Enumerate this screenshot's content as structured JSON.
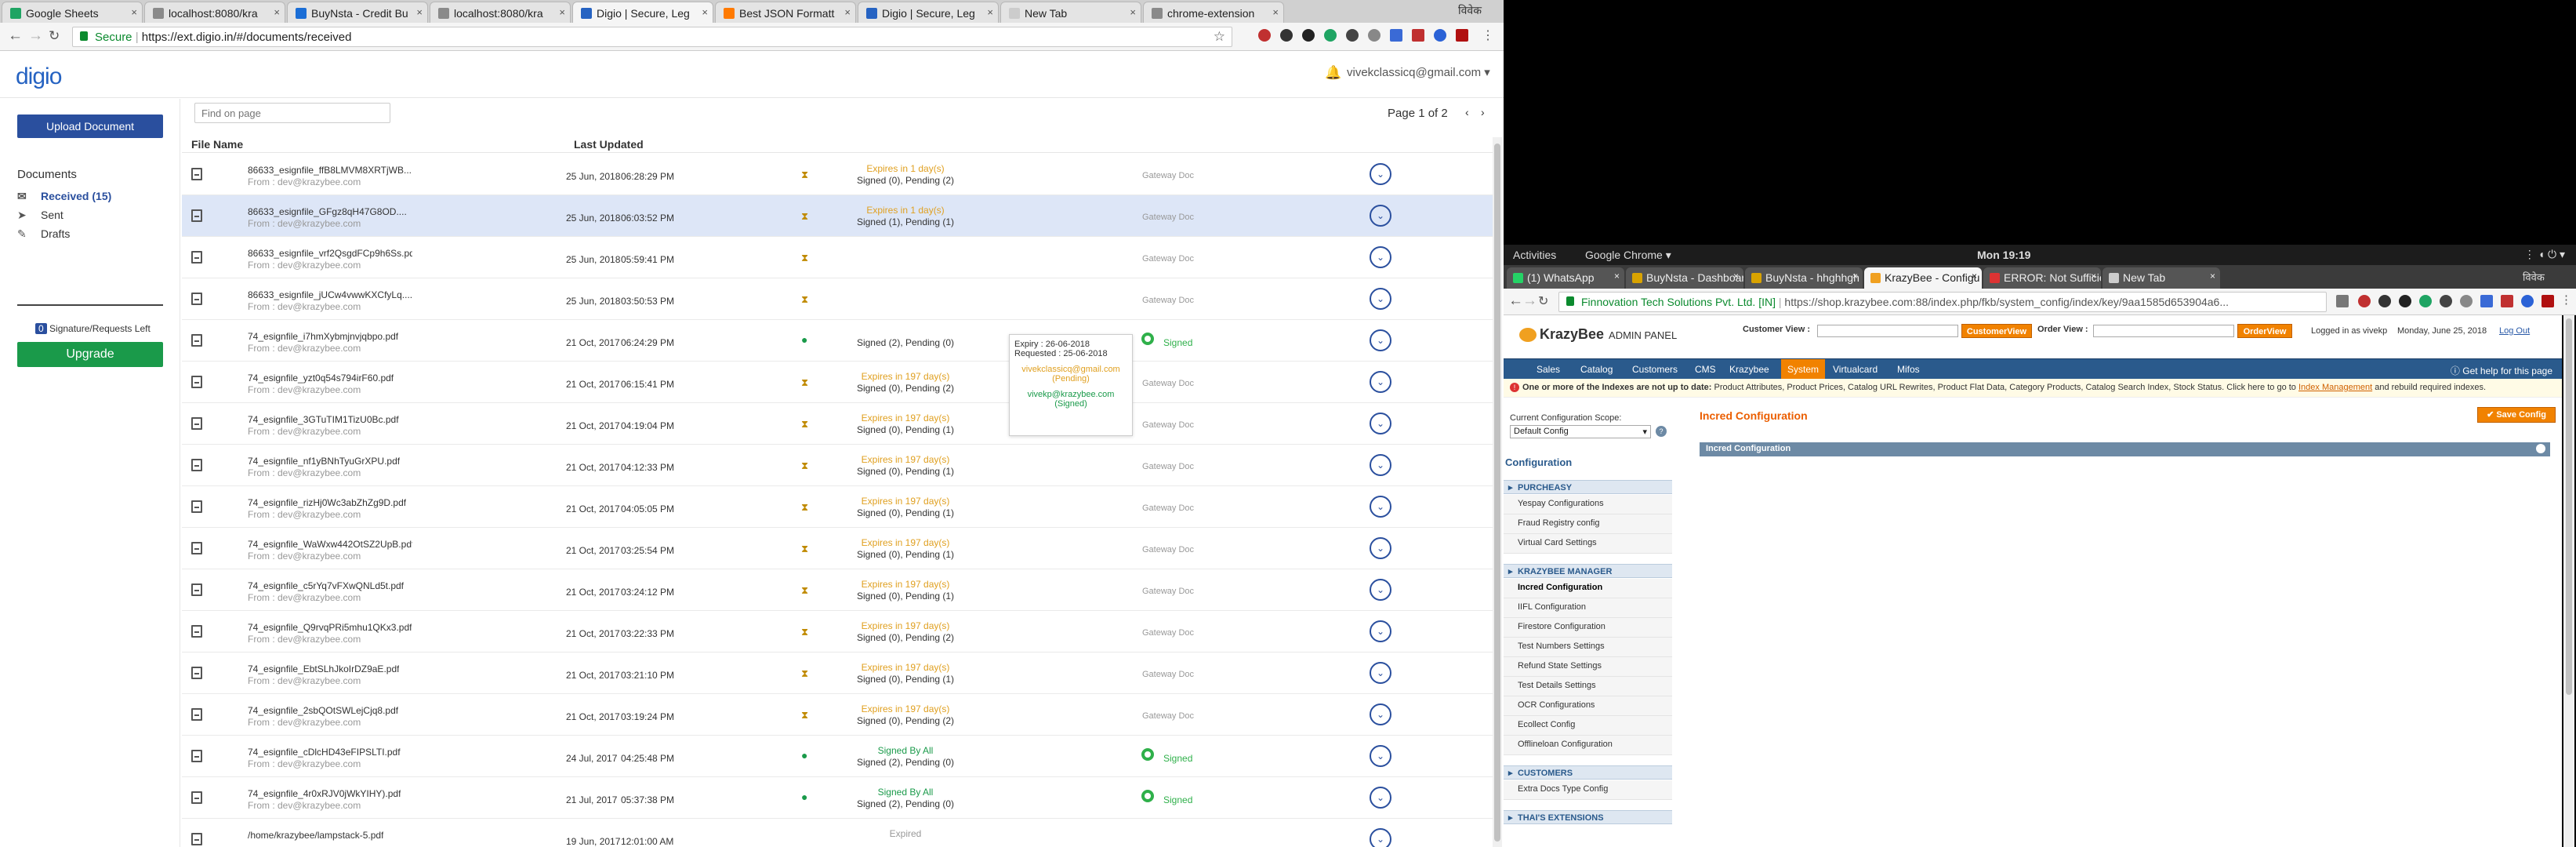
{
  "left_browser": {
    "tabs": [
      {
        "label": "Google Sheets",
        "color": "#1fa463"
      },
      {
        "label": "localhost:8080/kra",
        "color": "#8a8a8a"
      },
      {
        "label": "BuyNsta - Credit Bu",
        "color": "#1b6ed6"
      },
      {
        "label": "localhost:8080/kra",
        "color": "#8a8a8a"
      },
      {
        "label": "Digio | Secure, Leg",
        "color": "#2663c2"
      },
      {
        "label": "Best JSON Formatt",
        "color": "#ff7a00"
      },
      {
        "label": "Digio | Secure, Leg",
        "color": "#2663c2"
      },
      {
        "label": "New Tab",
        "color": "#cccccc"
      },
      {
        "label": "chrome-extension",
        "color": "#8a8a8a"
      }
    ],
    "profile_label": "विवेक",
    "secure_label": "Secure",
    "url": "https://ext.digio.in/#/documents/received"
  },
  "digio": {
    "logo": "digio",
    "user_email": "vivekclassicq@gmail.com",
    "upload_label": "Upload Document",
    "documents_heading": "Documents",
    "nav": [
      {
        "label": "Received (15)",
        "icon": "inbox-icon",
        "selected": true
      },
      {
        "label": "Sent",
        "icon": "send-icon",
        "selected": false
      },
      {
        "label": "Drafts",
        "icon": "pencil-icon",
        "selected": false
      }
    ],
    "signature_count": "0",
    "signature_label": "Signature/Requests Left",
    "upgrade_label": "Upgrade",
    "find_placeholder": "Find on page",
    "page_info": "Page 1 of 2",
    "columns": {
      "file": "File Name",
      "updated": "Last Updated"
    },
    "rows": [
      {
        "file": "86633_esignfile_ffB8LMVM8XRTjWB....",
        "from": "From : dev@krazybee.com",
        "date": "25 Jun, 2018",
        "time": "06:28:29 PM",
        "status": "pending",
        "line1": "Expires in 1 day(s)",
        "line2": "Signed (0), Pending (2)",
        "gateway": "Gateway Doc",
        "signed": ""
      },
      {
        "file": "86633_esignfile_GFgz8qH47G8OD....",
        "from": "From : dev@krazybee.com",
        "date": "25 Jun, 2018",
        "time": "06:03:52 PM",
        "status": "pending",
        "line1": "Expires in 1 day(s)",
        "line2": "Signed (1), Pending (1)",
        "gateway": "Gateway Doc",
        "signed": ""
      },
      {
        "file": "86633_esignfile_vrf2QsgdFCp9h6Ss.pdf",
        "from": "From : dev@krazybee.com",
        "date": "25 Jun, 2018",
        "time": "05:59:41 PM",
        "status": "pending",
        "line1": "",
        "line2": "",
        "gateway": "Gateway Doc",
        "signed": ""
      },
      {
        "file": "86633_esignfile_jUCw4vwwKXCfyLq....",
        "from": "From : dev@krazybee.com",
        "date": "25 Jun, 2018",
        "time": "03:50:53 PM",
        "status": "pending",
        "line1": "",
        "line2": "",
        "gateway": "Gateway Doc",
        "signed": ""
      },
      {
        "file": "74_esignfile_i7hmXybmjnvjqbpo.pdf",
        "from": "From : dev@krazybee.com",
        "date": "21 Oct, 2017",
        "time": "06:24:29 PM",
        "status": "ok",
        "line1": "",
        "line2": "Signed (2), Pending (0)",
        "gateway": "",
        "signed": "Signed"
      },
      {
        "file": "74_esignfile_yzt0q54s794irF60.pdf",
        "from": "From : dev@krazybee.com",
        "date": "21 Oct, 2017",
        "time": "06:15:41 PM",
        "status": "pending",
        "line1": "Expires in 197 day(s)",
        "line2": "Signed (0), Pending (2)",
        "gateway": "Gateway Doc",
        "signed": ""
      },
      {
        "file": "74_esignfile_3GTuTIM1TizU0Bc.pdf",
        "from": "From : dev@krazybee.com",
        "date": "21 Oct, 2017",
        "time": "04:19:04 PM",
        "status": "pending",
        "line1": "Expires in 197 day(s)",
        "line2": "Signed (0), Pending (1)",
        "gateway": "Gateway Doc",
        "signed": ""
      },
      {
        "file": "74_esignfile_nf1yBNhTyuGrXPU.pdf",
        "from": "From : dev@krazybee.com",
        "date": "21 Oct, 2017",
        "time": "04:12:33 PM",
        "status": "pending",
        "line1": "Expires in 197 day(s)",
        "line2": "Signed (0), Pending (1)",
        "gateway": "Gateway Doc",
        "signed": ""
      },
      {
        "file": "74_esignfile_rizHj0Wc3abZhZg9D.pdf",
        "from": "From : dev@krazybee.com",
        "date": "21 Oct, 2017",
        "time": "04:05:05 PM",
        "status": "pending",
        "line1": "Expires in 197 day(s)",
        "line2": "Signed (0), Pending (1)",
        "gateway": "Gateway Doc",
        "signed": ""
      },
      {
        "file": "74_esignfile_WaWxw442OtSZ2UpB.pdf",
        "from": "From : dev@krazybee.com",
        "date": "21 Oct, 2017",
        "time": "03:25:54 PM",
        "status": "pending",
        "line1": "Expires in 197 day(s)",
        "line2": "Signed (0), Pending (1)",
        "gateway": "Gateway Doc",
        "signed": ""
      },
      {
        "file": "74_esignfile_c5rYq7vFXwQNLd5t.pdf",
        "from": "From : dev@krazybee.com",
        "date": "21 Oct, 2017",
        "time": "03:24:12 PM",
        "status": "pending",
        "line1": "Expires in 197 day(s)",
        "line2": "Signed (0), Pending (1)",
        "gateway": "Gateway Doc",
        "signed": ""
      },
      {
        "file": "74_esignfile_Q9rvqPRi5mhu1QKx3.pdf",
        "from": "From : dev@krazybee.com",
        "date": "21 Oct, 2017",
        "time": "03:22:33 PM",
        "status": "pending",
        "line1": "Expires in 197 day(s)",
        "line2": "Signed (0), Pending (2)",
        "gateway": "Gateway Doc",
        "signed": ""
      },
      {
        "file": "74_esignfile_EbtSLhJkoIrDZ9aE.pdf",
        "from": "From : dev@krazybee.com",
        "date": "21 Oct, 2017",
        "time": "03:21:10 PM",
        "status": "pending",
        "line1": "Expires in 197 day(s)",
        "line2": "Signed (0), Pending (1)",
        "gateway": "Gateway Doc",
        "signed": ""
      },
      {
        "file": "74_esignfile_2sbQOtSWLejCjq8.pdf",
        "from": "From : dev@krazybee.com",
        "date": "21 Oct, 2017",
        "time": "03:19:24 PM",
        "status": "pending",
        "line1": "Expires in 197 day(s)",
        "line2": "Signed (0), Pending (2)",
        "gateway": "Gateway Doc",
        "signed": ""
      },
      {
        "file": "74_esignfile_cDlcHD43eFIPSLTI.pdf",
        "from": "From : dev@krazybee.com",
        "date": "24 Jul, 2017",
        "time": "04:25:48 PM",
        "status": "ok",
        "line1": "Signed By All",
        "line2": "Signed (2), Pending (0)",
        "gateway": "",
        "signed": "Signed"
      },
      {
        "file": "74_esignfile_4r0xRJV0jWkYIHY).pdf",
        "from": "From : dev@krazybee.com",
        "date": "21 Jul, 2017",
        "time": "05:37:38 PM",
        "status": "ok",
        "line1": "Signed By All",
        "line2": "Signed (2), Pending (0)",
        "gateway": "",
        "signed": "Signed"
      },
      {
        "file": "/home/krazybee/lampstack-5.pdf",
        "from": "",
        "date": "19 Jun, 2017",
        "time": "12:01:00 AM",
        "status": "none",
        "line1": "Expired",
        "line2": "",
        "gateway": "",
        "signed": ""
      }
    ],
    "tooltip": {
      "expiry": "Expiry : 26-06-2018",
      "requested": "Requested : 25-06-2018",
      "signer1_email": "vivekclassicq@gmail.com",
      "signer1_status": "(Pending)",
      "signer2_email": "vivekp@krazybee.com",
      "signer2_status": "(Signed)"
    }
  },
  "right_desktop": {
    "activities": "Activities",
    "app_name": "Google Chrome ▾",
    "clock": "Mon 19:19",
    "tabs": [
      {
        "label": "(1) WhatsApp",
        "color": "#25d366"
      },
      {
        "label": "BuyNsta - Dashboar",
        "color": "#d9a300"
      },
      {
        "label": "BuyNsta - hhghhgh",
        "color": "#d9a300"
      },
      {
        "label": "KrazyBee - Configu",
        "color": "#f0a020"
      },
      {
        "label": "ERROR: Not Sufficie",
        "color": "#d33"
      },
      {
        "label": "New Tab",
        "color": "#cccccc"
      }
    ],
    "profile_label": "विवेक",
    "secure_label": "Finnovation Tech Solutions Pvt. Ltd. [IN]",
    "url": "https://shop.krazybee.com:88/index.php/fkb/system_config/index/key/9aa1585d653904a6..."
  },
  "krazybee": {
    "logo": "KrazyBee",
    "admin": "ADMIN PANEL",
    "customer_view_label": "Customer View :",
    "customer_view_btn": "CustomerView",
    "order_view_label": "Order View :",
    "order_view_btn": "OrderView",
    "logged_in": "Logged in as vivekp",
    "date": "Monday, June 25, 2018",
    "logout": "Log Out",
    "nav": [
      "Sales",
      "Catalog",
      "Customers",
      "CMS",
      "Krazybee",
      "System",
      "Virtualcard",
      "Mifos"
    ],
    "nav_selected": "System",
    "help": "Get help for this page",
    "notice_bold": "One or more of the Indexes are not up to date:",
    "notice_text": " Product Attributes, Product Prices, Catalog URL Rewrites, Product Flat Data, Category Products, Catalog Search Index, Stock Status. Click here to go to ",
    "notice_link": "Index Management",
    "notice_tail": " and rebuild required indexes.",
    "scope_label": "Current Configuration Scope:",
    "scope_value": "Default Config",
    "config_heading": "Configuration",
    "sections": [
      {
        "title": "PURCHEASY",
        "links": [
          "Yespay Configurations",
          "Fraud Registry config",
          "Virtual Card Settings"
        ]
      },
      {
        "title": "KRAZYBEE MANAGER",
        "links": [
          "Incred Configuration",
          "IIFL Configuration",
          "Firestore Configuration",
          "Test Numbers Settings",
          "Refund State Settings",
          "Test Details Settings",
          "OCR Configurations",
          "Ecollect Config",
          "Offlineloan Configuration"
        ]
      },
      {
        "title": "CUSTOMERS",
        "links": [
          "Extra Docs Type Config"
        ]
      },
      {
        "title": "THAI'S EXTENSIONS",
        "links": []
      }
    ],
    "selected_link": "Incred Configuration",
    "page_title": "Incred Configuration",
    "save_label": "Save Config",
    "fieldset_title": "Incred Configuration"
  }
}
